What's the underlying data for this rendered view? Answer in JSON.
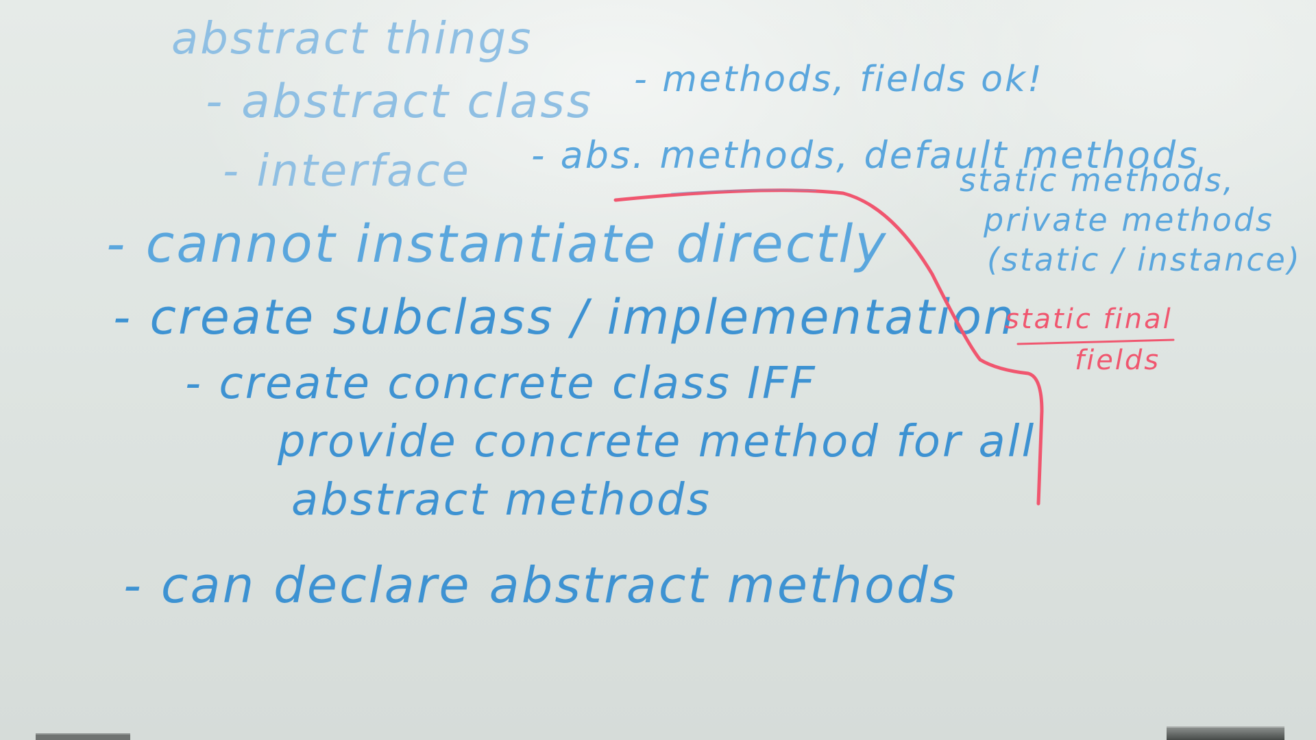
{
  "whiteboard": {
    "heading": "abstract things",
    "abstract_class_label": "- abstract class",
    "abstract_class_note": "- methods, fields ok!",
    "interface_label": "- interface",
    "interface_note": "- abs. methods, default methods",
    "interface_note_2": "static methods,",
    "interface_note_3": "private methods",
    "interface_note_4": "(static / instance)",
    "cannot_instantiate": "- cannot instantiate directly",
    "create_subclass": "- create subclass / implementation",
    "concrete_1": "- create concrete class IFF",
    "concrete_2": "provide concrete method for all",
    "concrete_3": "abstract methods",
    "can_declare": "- can declare abstract methods",
    "red_note_1": "static final",
    "red_note_2": "fields"
  },
  "colors": {
    "board": "#e3e8e5",
    "blue_marker": "#4a9ad8",
    "red_marker": "#f0566f"
  }
}
